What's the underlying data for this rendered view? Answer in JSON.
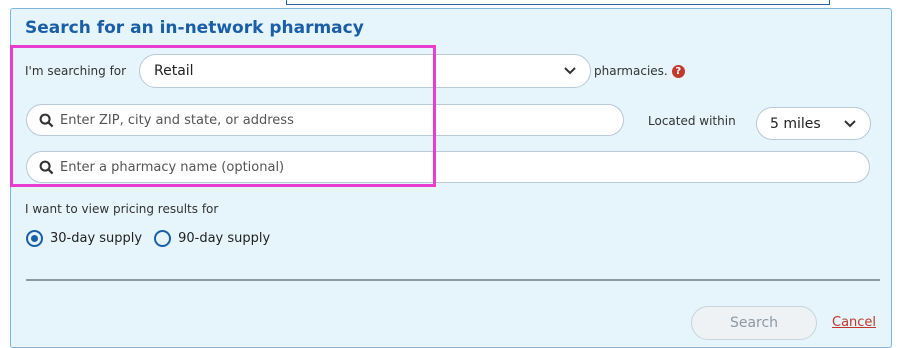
{
  "form": {
    "title": "Search for an in-network pharmacy",
    "searching_for_label": "I'm searching for",
    "pharmacy_type_value": "Retail",
    "pharmacies_suffix": "pharmacies.",
    "help_glyph": "?",
    "location_placeholder": "Enter ZIP, city and state, or address",
    "located_within_label": "Located within",
    "distance_value": "5 miles",
    "pharmacy_name_placeholder": "Enter a pharmacy name (optional)",
    "pricing_label": "I want to view pricing results for",
    "supply_options": [
      {
        "label": "30-day supply",
        "selected": true
      },
      {
        "label": "90-day supply",
        "selected": false
      }
    ],
    "search_label": "Search",
    "cancel_label": "Cancel"
  },
  "colors": {
    "panel_bg": "#e6f4fb",
    "title": "#1a5ea8",
    "highlight": "#e83ed0",
    "cancel_link": "#c0392b"
  }
}
